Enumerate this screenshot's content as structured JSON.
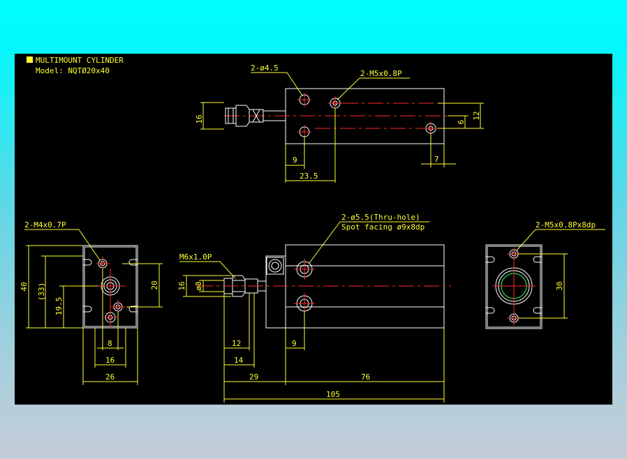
{
  "title": {
    "product": "MULTIMOUNT CYLINDER",
    "model": "Model: NQTØ20x40"
  },
  "colors": {
    "background": "#000000",
    "dimension": "#ffff33",
    "outline": "#ffffff",
    "centerline": "#ff2a2a",
    "bore": "#22dd44",
    "page_top": "#00ffff",
    "page_bottom": "#c4ccd8"
  },
  "top_view": {
    "holes_callout": "2-ø4.5",
    "tap_callout": "2-M5x0.8P",
    "dim_16": "16",
    "dim_12": "12",
    "dim_6": "6",
    "dim_9": "9",
    "dim_7": "7",
    "dim_23_5": "23.5"
  },
  "left_view": {
    "tap_callout": "2-M4x0.7P",
    "dim_40": "40",
    "dim_33": "(33)",
    "dim_19_5": "19.5",
    "dim_20": "20",
    "dim_8": "8",
    "dim_16": "16",
    "dim_26": "26"
  },
  "front_view": {
    "thread_callout": "M6x1.0P",
    "thruhole_callout": "2-ø5.5(Thru-hole)",
    "spotface_callout": "Spot facing ø9x8dp",
    "dim_16": "16",
    "dim_d8": "ø8",
    "dim_12": "12",
    "dim_14": "14",
    "dim_9": "9",
    "dim_29": "29",
    "dim_76": "76",
    "dim_105": "105"
  },
  "right_view": {
    "tap_callout": "2-M5x0.8Px8dp",
    "dim_30": "30"
  }
}
